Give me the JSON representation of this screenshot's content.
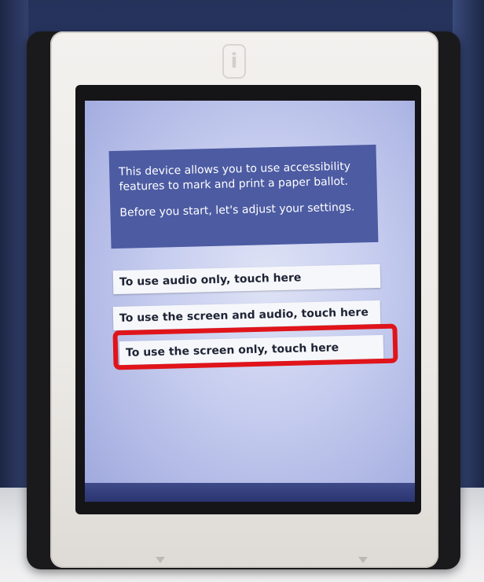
{
  "device": {
    "frame_logo": "i"
  },
  "info_box": {
    "line1": "This device allows you to use accessibility",
    "line2": "features to mark and print a paper ballot.",
    "line3": "Before you start, let's adjust your settings."
  },
  "options": [
    {
      "label": "To use audio only, touch here"
    },
    {
      "label": "To use the screen and audio, touch here"
    },
    {
      "label": "To use the screen only, touch here"
    }
  ],
  "highlight": {
    "target": "To use the screen only, touch here",
    "color": "#e0141a"
  },
  "colors": {
    "screen_background": "#c4cbee",
    "info_box_background": "#4c5ba2",
    "option_background": "#f6f7fb",
    "frame": "#eceae6"
  }
}
